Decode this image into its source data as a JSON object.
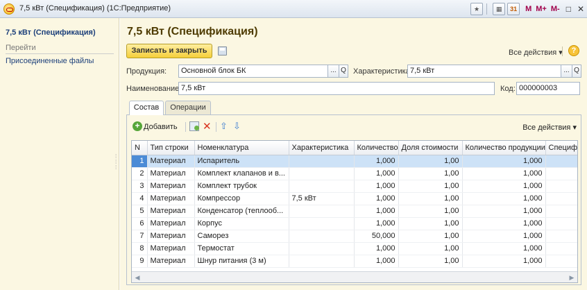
{
  "window": {
    "title": "7,5 кВт (Спецификация)  (1С:Предприятие)",
    "icons": [
      "app-logo-icon",
      "favorites-icon",
      "calculator-icon",
      "calendar-icon"
    ],
    "memory_buttons": [
      "M",
      "M+",
      "M-"
    ],
    "restore_glyph": "□",
    "close_glyph": "✕"
  },
  "left_panel": {
    "title": "7,5 кВт (Спецификация)",
    "goto_label": "Перейти",
    "links": [
      "Присоединенные файлы"
    ]
  },
  "form": {
    "title": "7,5 кВт (Спецификация)",
    "save_close_label": "Записать и закрыть",
    "all_actions_label": "Все действия",
    "help_glyph": "?",
    "product_label": "Продукция:",
    "product_value": "Основной блок БК",
    "characteristic_label": "Характеристика:",
    "characteristic_value": "7,5 кВт",
    "name_label": "Наименование:",
    "name_value": "7,5 кВт",
    "code_label": "Код:",
    "code_value": "000000003",
    "select_glyph": "...",
    "open_glyph": "Q"
  },
  "tabs": [
    {
      "label": "Состав",
      "active": true
    },
    {
      "label": "Операции",
      "active": false
    }
  ],
  "table_toolbar": {
    "add_label": "Добавить",
    "all_actions_label": "Все действия"
  },
  "table": {
    "columns": [
      "N",
      "Тип строки",
      "Номенклатура",
      "Характеристика",
      "Количество",
      "Доля стоимости",
      "Количество продукции",
      "Специфи"
    ],
    "rows": [
      [
        "1",
        "Материал",
        "Испаритель",
        "",
        "1,000",
        "1,00",
        "1,000",
        ""
      ],
      [
        "2",
        "Материал",
        "Комплект клапанов и в...",
        "",
        "1,000",
        "1,00",
        "1,000",
        ""
      ],
      [
        "3",
        "Материал",
        "Комплект трубок",
        "",
        "1,000",
        "1,00",
        "1,000",
        ""
      ],
      [
        "4",
        "Материал",
        "Компрессор",
        "7,5 кВт",
        "1,000",
        "1,00",
        "1,000",
        ""
      ],
      [
        "5",
        "Материал",
        "Конденсатор (теплооб...",
        "",
        "1,000",
        "1,00",
        "1,000",
        ""
      ],
      [
        "6",
        "Материал",
        "Корпус",
        "",
        "1,000",
        "1,00",
        "1,000",
        ""
      ],
      [
        "7",
        "Материал",
        "Саморез",
        "",
        "50,000",
        "1,00",
        "1,000",
        ""
      ],
      [
        "8",
        "Материал",
        "Термостат",
        "",
        "1,000",
        "1,00",
        "1,000",
        ""
      ],
      [
        "9",
        "Материал",
        "Шнур питания (3 м)",
        "",
        "1,000",
        "1,00",
        "1,000",
        ""
      ]
    ],
    "selected_row": 0
  },
  "colors": {
    "form_background": "#fbf7e2",
    "primary_button": "#f5cf3a",
    "selection": "#cde2f7",
    "title_color": "#4d3a00"
  }
}
